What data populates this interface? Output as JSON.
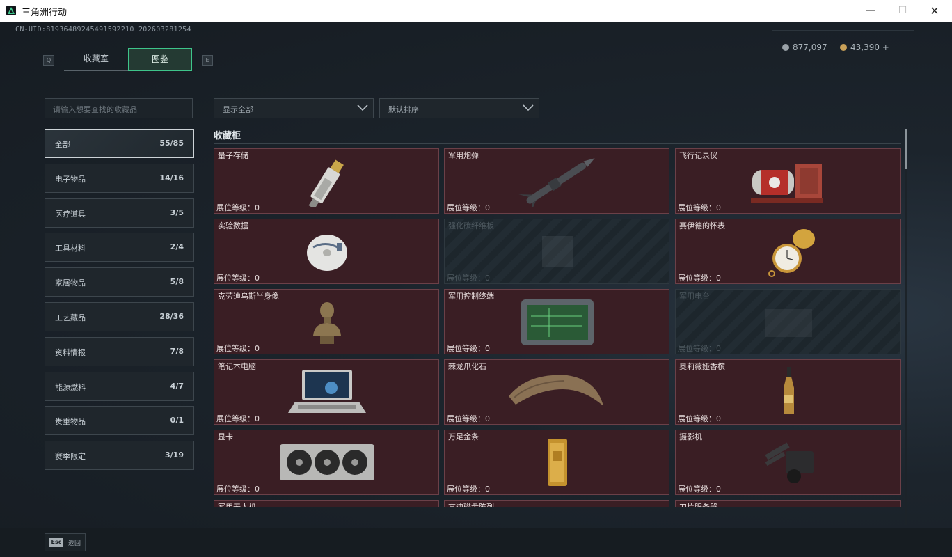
{
  "window": {
    "title": "三角洲行动",
    "minimize": "—",
    "maximize": "☐",
    "close": "✕"
  },
  "uid": "CN-UID:81936489245491592210_202603281254",
  "tabs": [
    {
      "label": "收藏室"
    },
    {
      "label": "图鉴"
    }
  ],
  "tab_keys": {
    "prev": "Q",
    "next": "E"
  },
  "currency": {
    "silver": "877,097",
    "gold": "43,390 +"
  },
  "search": {
    "placeholder": "请输入想要查找的收藏品"
  },
  "categories": [
    {
      "label": "全部",
      "count": "55/85",
      "active": true
    },
    {
      "label": "电子物品",
      "count": "14/16"
    },
    {
      "label": "医疗道具",
      "count": "3/5"
    },
    {
      "label": "工具材料",
      "count": "2/4"
    },
    {
      "label": "家居物品",
      "count": "5/8"
    },
    {
      "label": "工艺藏品",
      "count": "28/36"
    },
    {
      "label": "资料情报",
      "count": "7/8"
    },
    {
      "label": "能源燃料",
      "count": "4/7"
    },
    {
      "label": "贵重物品",
      "count": "0/1"
    },
    {
      "label": "赛季限定",
      "count": "3/19"
    }
  ],
  "filters": {
    "display": "显示全部",
    "sort": "默认排序"
  },
  "section_title": "收藏柜",
  "level_label": "展位等级：",
  "items": [
    {
      "name": "量子存储",
      "level": "0",
      "icon": "usb-drive",
      "locked": false
    },
    {
      "name": "军用炮弹",
      "level": "0",
      "icon": "missile",
      "locked": false
    },
    {
      "name": "飞行记录仪",
      "level": "0",
      "icon": "flight-recorder",
      "locked": false
    },
    {
      "name": "实验数据",
      "level": "0",
      "icon": "cd-disc",
      "locked": false
    },
    {
      "name": "强化碳纤维板",
      "level": "0",
      "icon": "carbon-plate",
      "locked": true
    },
    {
      "name": "赛伊德的怀表",
      "level": "0",
      "icon": "pocket-watch",
      "locked": false
    },
    {
      "name": "克劳迪乌斯半身像",
      "level": "0",
      "icon": "bust",
      "locked": false
    },
    {
      "name": "军用控制终端",
      "level": "0",
      "icon": "control-terminal",
      "locked": false
    },
    {
      "name": "军用电台",
      "level": "0",
      "icon": "radio",
      "locked": true
    },
    {
      "name": "笔记本电脑",
      "level": "0",
      "icon": "laptop",
      "locked": false
    },
    {
      "name": "棘龙爪化石",
      "level": "0",
      "icon": "claw-fossil",
      "locked": false
    },
    {
      "name": "奥莉薇娅香槟",
      "level": "0",
      "icon": "champagne",
      "locked": false
    },
    {
      "name": "显卡",
      "level": "0",
      "icon": "graphics-card",
      "locked": false
    },
    {
      "name": "万足金条",
      "level": "0",
      "icon": "gold-bar",
      "locked": false
    },
    {
      "name": "摄影机",
      "level": "0",
      "icon": "camera",
      "locked": false
    },
    {
      "name": "军用无人机",
      "level": "",
      "icon": "drone",
      "locked": false
    },
    {
      "name": "高速磁盘阵列",
      "level": "",
      "icon": "disk-array",
      "locked": false
    },
    {
      "name": "刀片服务器",
      "level": "",
      "icon": "blade-server",
      "locked": false
    }
  ],
  "footer": {
    "key": "Esc",
    "label": "返回"
  }
}
